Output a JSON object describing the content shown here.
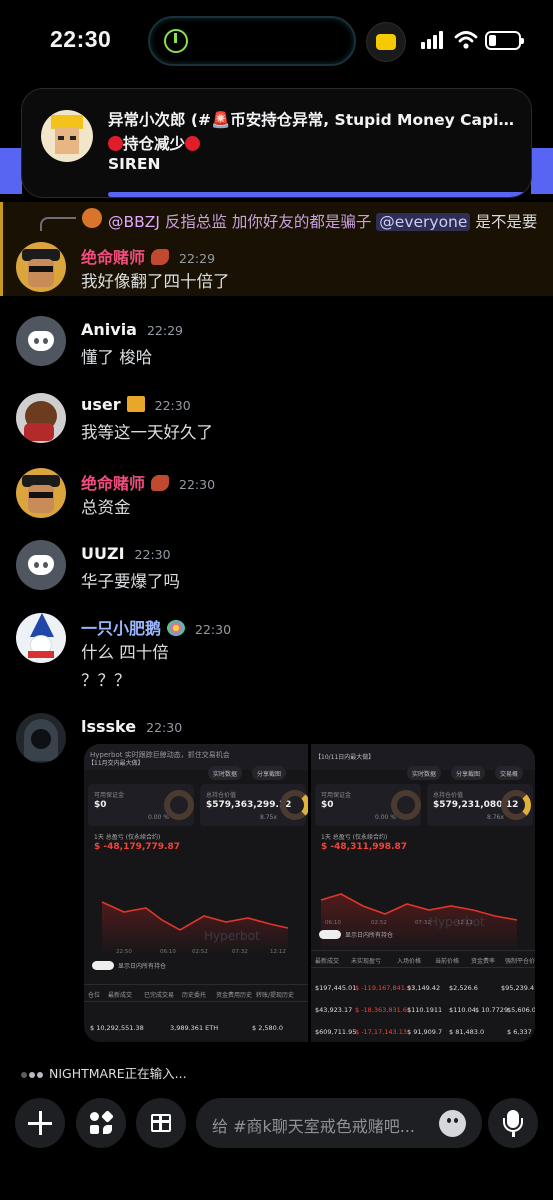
{
  "status_bar": {
    "time": "22:30"
  },
  "notification": {
    "title": "异常小次郎 (#🚨币安持仓异常, Stupid Money Capital...",
    "line2": "持仓减少",
    "line3": "SIREN"
  },
  "reply": {
    "author": "@BBZJ",
    "text": "反指总监  加你好友的都是骗子",
    "mention": "@everyone",
    "tail": "是不是要"
  },
  "messages": [
    {
      "author": "绝命赌师",
      "time": "22:29",
      "lines": [
        "我好像翻了四十倍了"
      ]
    },
    {
      "author": "Anivia",
      "time": "22:29",
      "lines": [
        "懂了 梭哈"
      ]
    },
    {
      "author": "user",
      "time": "22:30",
      "lines": [
        "我等这一天好久了"
      ]
    },
    {
      "author": "绝命赌师",
      "time": "22:30",
      "lines": [
        "总资金"
      ]
    },
    {
      "author": "UUZI",
      "time": "22:30",
      "lines": [
        "华子要爆了吗"
      ]
    },
    {
      "author": "一只小肥鹅",
      "time": "22:30",
      "lines": [
        "什么 四十倍",
        "？？？"
      ]
    },
    {
      "author": "lssske",
      "time": "22:30",
      "lines": []
    }
  ],
  "attachments": {
    "left": {
      "header": "Hyperbot 实时跟踪巨鲸动态，抓住交易机会",
      "tab_label": "【11月交内最大做】",
      "pill_1": "实时数据",
      "pill_2": "分享截图",
      "card1_label": "可用保证金",
      "card1_value": "$0",
      "card1_sub": "0.00 %",
      "card2_label": "总持仓价值",
      "card2_value": "$579,363,299.12",
      "card2_sub": "8.75x",
      "pnl_label": "1天 总盈亏 (仅永续合约)",
      "pnl_value": "$ -48,179,779.87",
      "watermark": "Hyperbot",
      "ticks": [
        "22:50",
        "06:10",
        "02:52",
        "07:32",
        "12:12"
      ],
      "toggle_label": "显示日内所有持仓",
      "tabs": [
        "仓位",
        "最新成交",
        "已完成交易",
        "历史委托",
        "资金费用历史",
        "转账/提现历史"
      ],
      "row": [
        "$ 10,292,551.38",
        "3,989.361 ETH",
        "$ 2,580.0"
      ]
    },
    "right": {
      "tab_label": "【10/11日内最大做】",
      "pill_1": "实时数据",
      "pill_2": "分享截图",
      "pill_3": "交易概",
      "card1_label": "可用保证金",
      "card1_value": "$0",
      "card1_sub": "0.00 %",
      "card2_label": "总持仓价值",
      "card2_value": "$579,231,080.12",
      "card2_sub": "8.76x",
      "pnl_label": "1天 总盈亏 (仅永续合约)",
      "pnl_value": "$ -48,311,998.87",
      "watermark": "Hyperbot",
      "ticks": [
        "06:10",
        "02:52",
        "07:32",
        "12:12"
      ],
      "toggle_label": "显示日内所有持仓",
      "tabs": [
        "最新成交",
        "未实现盈亏",
        "入场价格",
        "当前价格",
        "资金费率",
        "强制平仓价格"
      ],
      "rows": [
        [
          "$197,445.01",
          "$ -119,167,841.97",
          "$3,149.42",
          "$2,526.6",
          "$95,239.4"
        ],
        [
          "$43,923.17",
          "$ -18,363,831.61",
          "$110.1911",
          "$110.04",
          "$ 10.7729",
          "$5,606.0"
        ],
        [
          "$609,711.95",
          "$ -17,17,143.13",
          "$ 91,909.7",
          "$ 81,483.0",
          "$ 6,337"
        ]
      ]
    }
  },
  "typing": {
    "text": "NIGHTMARE正在输入..."
  },
  "composer": {
    "placeholder": "给 #商k聊天室戒色戒赌吧..."
  }
}
